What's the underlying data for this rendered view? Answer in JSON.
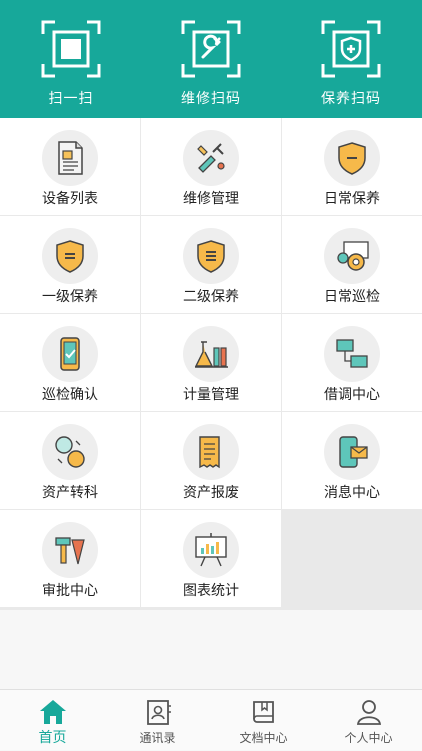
{
  "header": {
    "items": [
      {
        "label": "扫一扫",
        "icon": "scan-square-icon"
      },
      {
        "label": "维修扫码",
        "icon": "wrench-scan-icon"
      },
      {
        "label": "保养扫码",
        "icon": "shield-scan-icon"
      }
    ],
    "color": "#17a89a"
  },
  "grid": {
    "items": [
      {
        "label": "设备列表",
        "icon": "document-list-icon"
      },
      {
        "label": "维修管理",
        "icon": "tools-icon"
      },
      {
        "label": "日常保养",
        "icon": "shield-minus-icon"
      },
      {
        "label": "一级保养",
        "icon": "shield-level1-icon"
      },
      {
        "label": "二级保养",
        "icon": "shield-level2-icon"
      },
      {
        "label": "日常巡检",
        "icon": "gears-icon"
      },
      {
        "label": "巡检确认",
        "icon": "phone-check-icon"
      },
      {
        "label": "计量管理",
        "icon": "lab-flask-icon"
      },
      {
        "label": "借调中心",
        "icon": "monitors-icon"
      },
      {
        "label": "资产转科",
        "icon": "coins-transfer-icon"
      },
      {
        "label": "资产报废",
        "icon": "receipt-icon"
      },
      {
        "label": "消息中心",
        "icon": "phone-mail-icon"
      },
      {
        "label": "审批中心",
        "icon": "stamp-icon"
      },
      {
        "label": "图表统计",
        "icon": "chart-board-icon"
      }
    ]
  },
  "tabbar": {
    "tabs": [
      {
        "label": "首页",
        "icon": "home-icon",
        "active": true
      },
      {
        "label": "通讯录",
        "icon": "contacts-icon",
        "active": false
      },
      {
        "label": "文档中心",
        "icon": "book-icon",
        "active": false
      },
      {
        "label": "个人中心",
        "icon": "person-icon",
        "active": false
      }
    ],
    "active_color": "#17a89a"
  }
}
